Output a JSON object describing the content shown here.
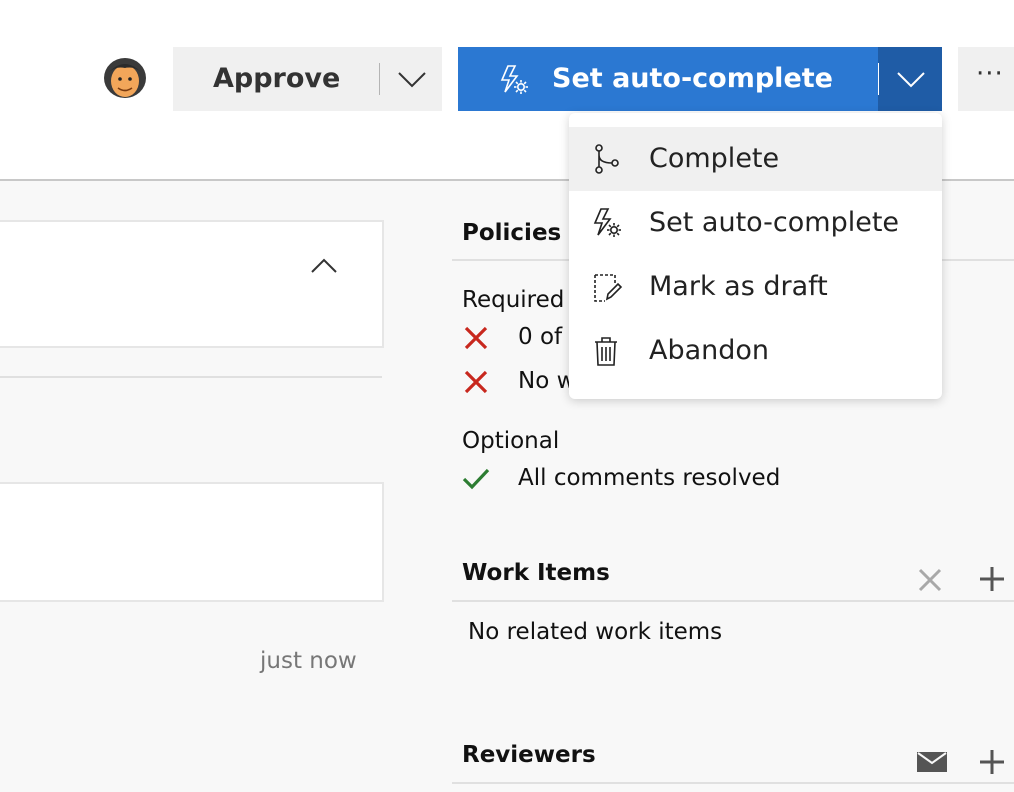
{
  "header": {
    "approve_label": "Approve",
    "autocomplete_label": "Set auto-complete",
    "more_label": "···"
  },
  "menu": {
    "items": [
      {
        "label": "Complete",
        "icon": "branch-merge-icon"
      },
      {
        "label": "Set auto-complete",
        "icon": "bolt-gear-icon"
      },
      {
        "label": "Mark as draft",
        "icon": "draft-edit-icon"
      },
      {
        "label": "Abandon",
        "icon": "trash-icon"
      }
    ]
  },
  "left": {
    "timestamp": "just now"
  },
  "policies": {
    "title": "Policies",
    "required_label": "Required",
    "required_items": [
      {
        "text": "0 of",
        "status": "failed"
      },
      {
        "text": "No w",
        "status": "failed"
      }
    ],
    "optional_label": "Optional",
    "optional_items": [
      {
        "text": "All comments resolved",
        "status": "passed"
      }
    ]
  },
  "work_items": {
    "title": "Work Items",
    "empty_text": "No related work items"
  },
  "reviewers": {
    "title": "Reviewers"
  },
  "colors": {
    "primary": "#2b78d2",
    "primary_dark": "#1f5ca6",
    "fail": "#c8281e",
    "pass": "#2d7d32"
  }
}
